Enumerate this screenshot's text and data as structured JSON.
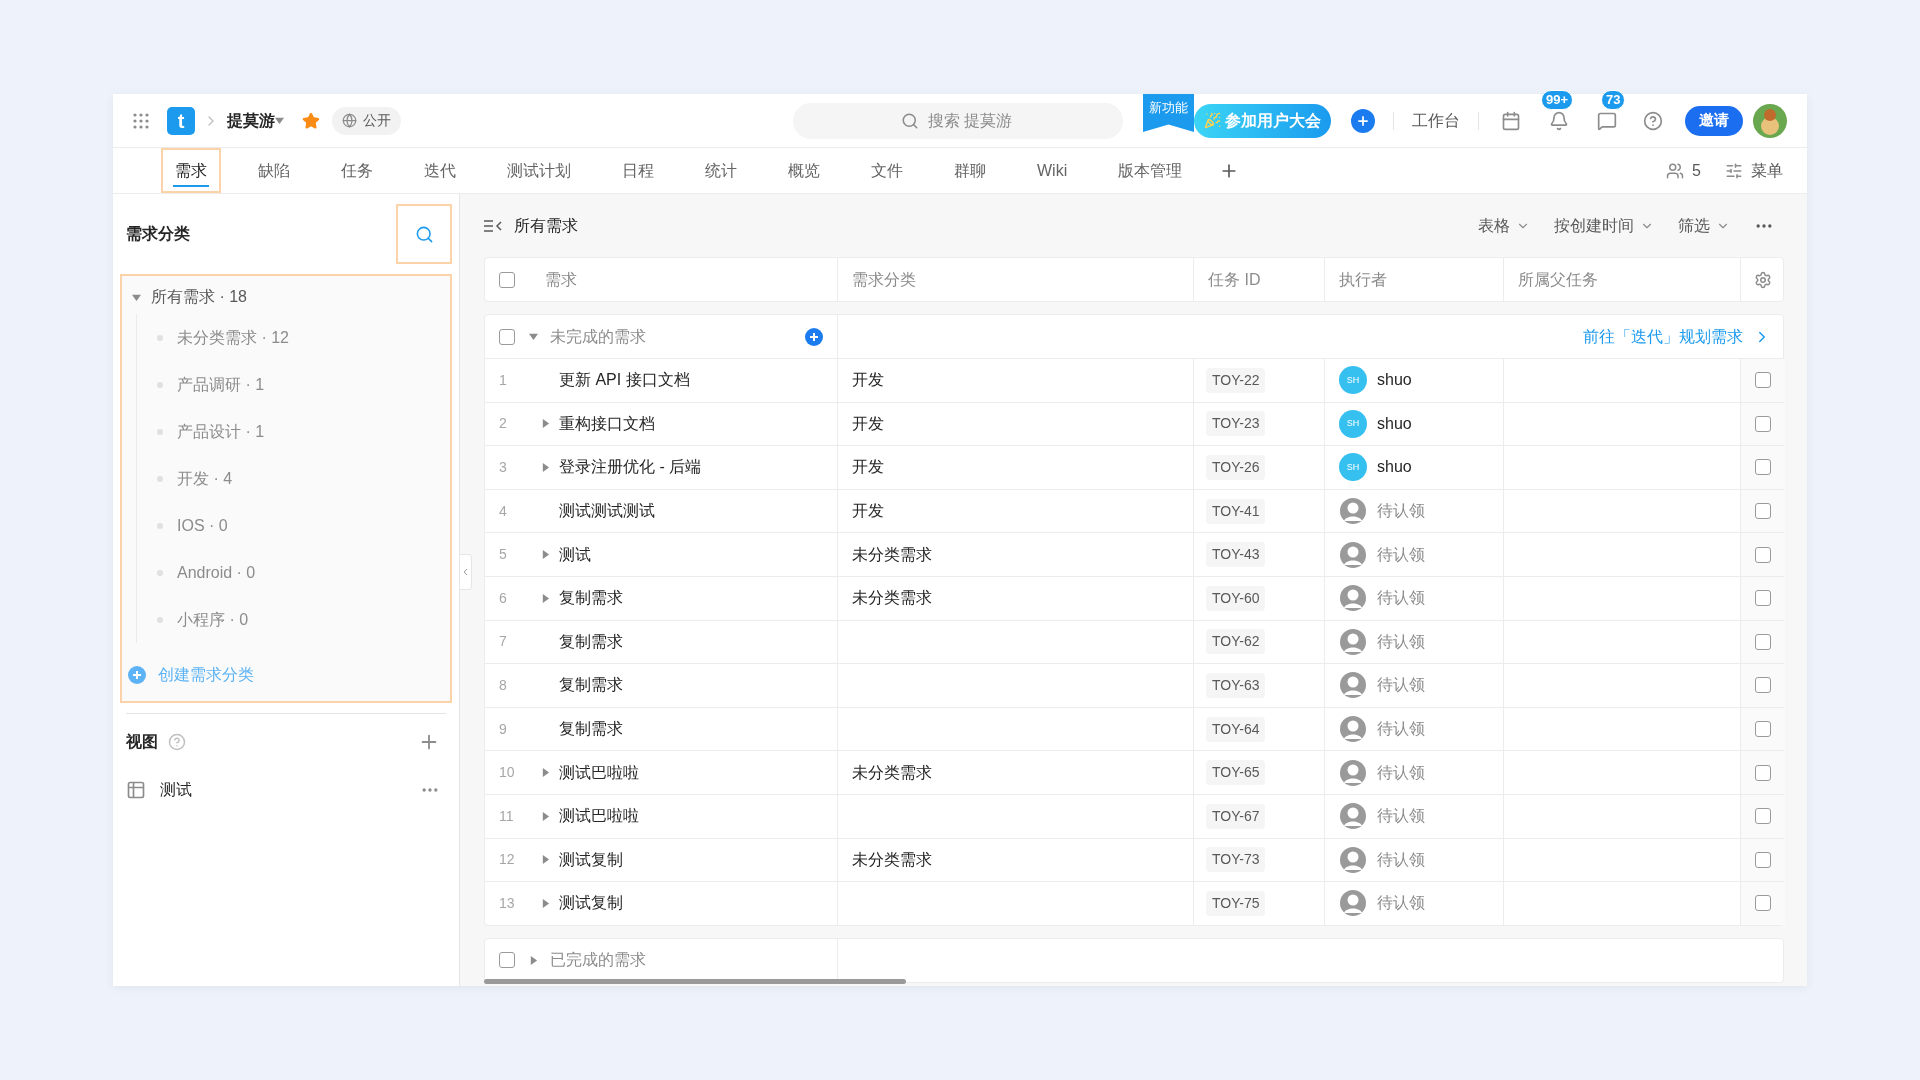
{
  "topbar": {
    "logo_letter": "t",
    "project_name": "提莫游",
    "favorited": true,
    "visibility": "公开",
    "search": {
      "placeholder": "搜索 提莫游"
    },
    "new_feature_ribbon": "新功能",
    "event_button": "参加用户大会",
    "workbench": "工作台",
    "notification_badge": "99+",
    "message_badge": "73",
    "invite_button": "邀请"
  },
  "tabs": [
    {
      "label": "需求",
      "selected": true,
      "highlighted": true
    },
    {
      "label": "缺陷",
      "selected": false,
      "highlighted": false
    },
    {
      "label": "任务",
      "selected": false,
      "highlighted": false
    },
    {
      "label": "迭代",
      "selected": false,
      "highlighted": false
    },
    {
      "label": "测试计划",
      "selected": false,
      "highlighted": false
    },
    {
      "label": "日程",
      "selected": false,
      "highlighted": false
    },
    {
      "label": "统计",
      "selected": false,
      "highlighted": false
    },
    {
      "label": "概览",
      "selected": false,
      "highlighted": false
    },
    {
      "label": "文件",
      "selected": false,
      "highlighted": false
    },
    {
      "label": "群聊",
      "selected": false,
      "highlighted": false
    },
    {
      "label": "Wiki",
      "selected": false,
      "highlighted": false
    },
    {
      "label": "版本管理",
      "selected": false,
      "highlighted": false
    }
  ],
  "tab_tools": {
    "member_count": "5",
    "menu": "菜单"
  },
  "sidebar": {
    "title": "需求分类",
    "search_highlighted": true,
    "tree": {
      "label": "所有需求 · 18",
      "expanded": true,
      "highlighted": true,
      "children": [
        {
          "label": "未分类需求 · 12"
        },
        {
          "label": "产品调研 · 1"
        },
        {
          "label": "产品设计 · 1"
        },
        {
          "label": "开发 · 4"
        },
        {
          "label": "IOS · 0"
        },
        {
          "label": "Android · 0"
        },
        {
          "label": "小程序 · 0"
        }
      ]
    },
    "create_link": "创建需求分类",
    "views_title": "视图",
    "views": [
      {
        "label": "测试"
      }
    ]
  },
  "main": {
    "title": "所有需求",
    "toolbar": [
      "表格",
      "按创建时间",
      "筛选"
    ],
    "columns": [
      "需求",
      "需求分类",
      "任务 ID",
      "执行者",
      "所属父任务"
    ],
    "header_checked": false,
    "groups": [
      {
        "label": "未完成的需求",
        "expanded": true,
        "checked": false,
        "link": "前往「迭代」规划需求",
        "rows": [
          {
            "num": "1",
            "has_subtasks": false,
            "title": "更新 API 接口文档",
            "category": "开发",
            "id": "TOY-22",
            "assignee": {
              "kind": "user",
              "initials": "SH",
              "name": "shuo"
            },
            "checked": false
          },
          {
            "num": "2",
            "has_subtasks": true,
            "title": "重构接口文档",
            "category": "开发",
            "id": "TOY-23",
            "assignee": {
              "kind": "user",
              "initials": "SH",
              "name": "shuo"
            },
            "checked": false
          },
          {
            "num": "3",
            "has_subtasks": true,
            "title": "登录注册优化 - 后端",
            "category": "开发",
            "id": "TOY-26",
            "assignee": {
              "kind": "user",
              "initials": "SH",
              "name": "shuo"
            },
            "checked": false
          },
          {
            "num": "4",
            "has_subtasks": false,
            "title": "测试测试测试",
            "category": "开发",
            "id": "TOY-41",
            "assignee": {
              "kind": "unclaimed",
              "name": "待认领"
            },
            "checked": false
          },
          {
            "num": "5",
            "has_subtasks": true,
            "title": "测试",
            "category": "未分类需求",
            "id": "TOY-43",
            "assignee": {
              "kind": "unclaimed",
              "name": "待认领"
            },
            "checked": false
          },
          {
            "num": "6",
            "has_subtasks": true,
            "title": "复制需求",
            "category": "未分类需求",
            "id": "TOY-60",
            "assignee": {
              "kind": "unclaimed",
              "name": "待认领"
            },
            "checked": false
          },
          {
            "num": "7",
            "has_subtasks": false,
            "title": "复制需求",
            "id": "TOY-62",
            "assignee": {
              "kind": "unclaimed",
              "name": "待认领"
            },
            "checked": false
          },
          {
            "num": "8",
            "has_subtasks": false,
            "title": "复制需求",
            "id": "TOY-63",
            "assignee": {
              "kind": "unclaimed",
              "name": "待认领"
            },
            "checked": false
          },
          {
            "num": "9",
            "has_subtasks": false,
            "title": "复制需求",
            "id": "TOY-64",
            "assignee": {
              "kind": "unclaimed",
              "name": "待认领"
            },
            "checked": false
          },
          {
            "num": "10",
            "has_subtasks": true,
            "title": "测试巴啦啦",
            "category": "未分类需求",
            "id": "TOY-65",
            "assignee": {
              "kind": "unclaimed",
              "name": "待认领"
            },
            "checked": false
          },
          {
            "num": "11",
            "has_subtasks": true,
            "title": "测试巴啦啦",
            "id": "TOY-67",
            "assignee": {
              "kind": "unclaimed",
              "name": "待认领"
            },
            "checked": false
          },
          {
            "num": "12",
            "has_subtasks": true,
            "title": "测试复制",
            "category": "未分类需求",
            "id": "TOY-73",
            "assignee": {
              "kind": "unclaimed",
              "name": "待认领"
            },
            "checked": false
          },
          {
            "num": "13",
            "has_subtasks": true,
            "title": "测试复制",
            "id": "TOY-75",
            "assignee": {
              "kind": "unclaimed",
              "name": "待认领"
            },
            "checked": false
          }
        ]
      },
      {
        "label": "已完成的需求",
        "expanded": false,
        "checked": false
      }
    ]
  }
}
